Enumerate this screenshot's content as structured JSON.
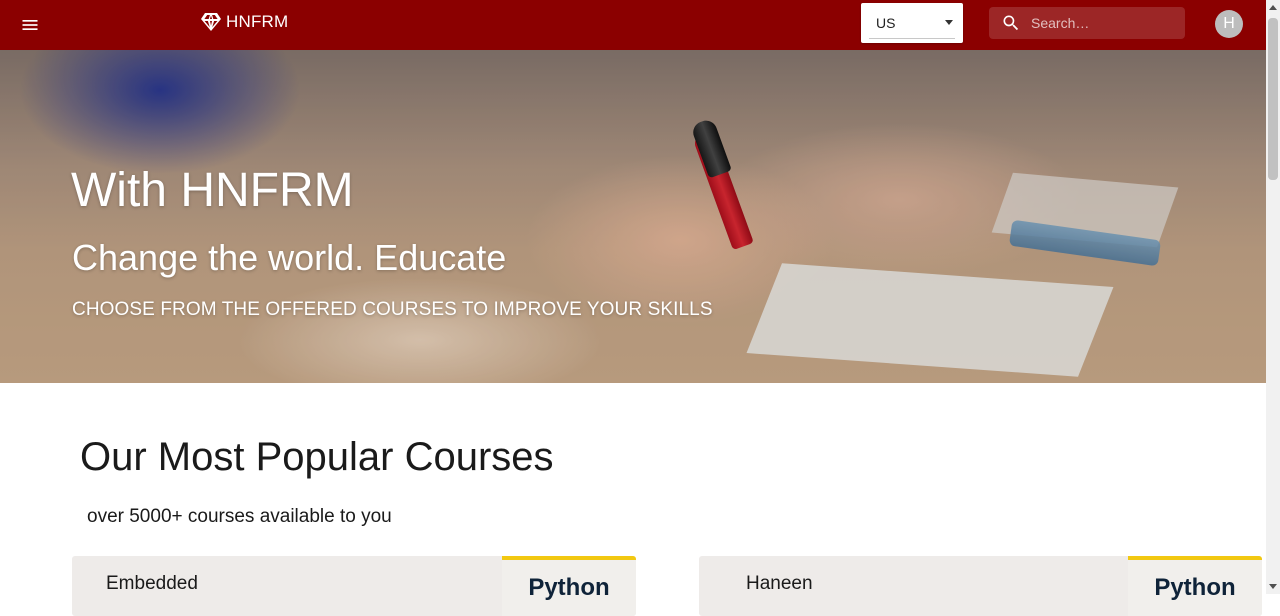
{
  "header": {
    "menu_icon": "hamburger-menu-icon",
    "brand_icon": "diamond-icon",
    "brand_name": "HNFRM",
    "locale": {
      "selected": "US"
    },
    "search": {
      "placeholder": "Search…",
      "icon": "search-icon"
    },
    "avatar_initial": "H",
    "background_color": "#8b0000"
  },
  "hero": {
    "title": "With HNFRM",
    "subtitle": "Change the world. Educate",
    "tagline": "CHOOSE FROM THE OFFERED COURSES TO IMPROVE YOUR SKILLS"
  },
  "popular": {
    "title": "Our Most Popular Courses",
    "subtitle": "over 5000+ courses available to you",
    "courses": [
      {
        "name": "Embedded",
        "thumbnail_text": "Python"
      },
      {
        "name": "Haneen",
        "thumbnail_text": "Python"
      }
    ]
  },
  "colors": {
    "brand": "#8b0000",
    "thumbnail_accent": "#f2c811"
  }
}
